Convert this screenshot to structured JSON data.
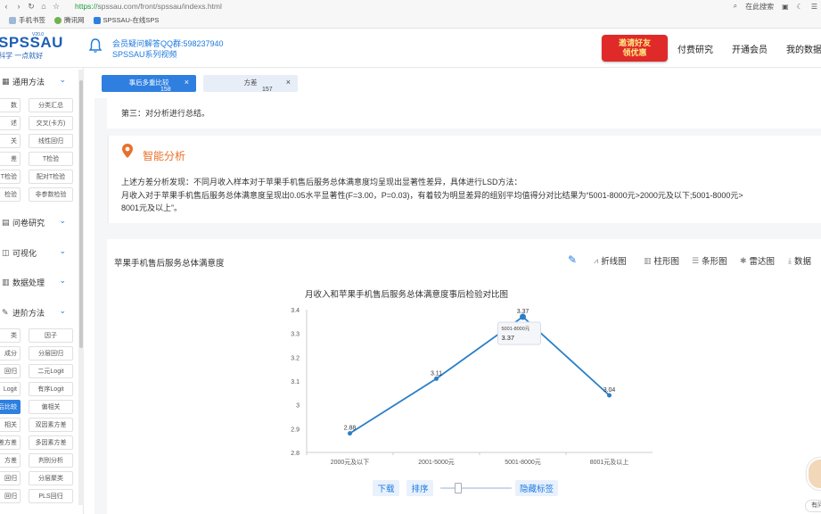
{
  "browser": {
    "url_proto": "https://",
    "url_rest": "spssau.com/front/spssau/indexs.html",
    "search_label": "在此搜索",
    "bookmarks": [
      "手机书签",
      "腾讯网",
      "SPSSAU-在线SPS"
    ]
  },
  "header": {
    "logo": "SPSSAU",
    "logo_sub": "科学  一点就好",
    "logo_version": "V20.0",
    "qq_group": "会员疑问解答QQ群:598237940",
    "video_link": "SPSSAU系列视频",
    "invite_line1": "邀请好友",
    "invite_line2": "领优惠",
    "nav": [
      "付费研究",
      "开通会员",
      "我的数据"
    ]
  },
  "sidebar": {
    "sections": [
      {
        "label": "通用方法",
        "icon": "grid-icon"
      },
      {
        "label": "问卷研究",
        "icon": "form-icon"
      },
      {
        "label": "可视化",
        "icon": "chart-icon"
      },
      {
        "label": "数据处理",
        "icon": "data-icon"
      },
      {
        "label": "进阶方法",
        "icon": "tool-icon"
      }
    ],
    "general_methods": [
      [
        "数",
        "分类汇总"
      ],
      [
        "述",
        "交叉(卡方)"
      ],
      [
        "关",
        "线性回归"
      ],
      [
        "差",
        "T检验"
      ],
      [
        "T检验",
        "配对T检验"
      ],
      [
        "检验",
        "非参数检验"
      ]
    ],
    "advanced_methods": [
      [
        "类",
        "因子"
      ],
      [
        "成分",
        "分层回归"
      ],
      [
        "回归",
        "二元Logit"
      ],
      [
        "Logit",
        "有序Logit"
      ],
      [
        "事后比较",
        "偏相关"
      ],
      [
        "相关",
        "双因素方差"
      ],
      [
        "差方差",
        "多因素方差"
      ],
      [
        "方差",
        "判别分析"
      ],
      [
        "回归",
        "分层聚类"
      ],
      [
        "回归",
        "PLS回归"
      ]
    ]
  },
  "tabs": [
    {
      "label": "事后多重比较",
      "count": "158",
      "close": "×",
      "active": true
    },
    {
      "label": "方差",
      "count": "157",
      "close": "×",
      "active": false
    }
  ],
  "content": {
    "step3": "第三：对分析进行总结。",
    "smart_title": "智能分析",
    "para1": "上述方差分析发现：不同月收入样本对于苹果手机售后服务总体满意度均呈现出显著性差异，具体进行LSD方法：",
    "para2": "月收入对于苹果手机售后服务总体满意度呈现出0.05水平显著性(F=3.00，P=0.03)，有着较为明显差异的组别平均值得分对比结果为“5001-8000元>2000元及以下;5001-8000元>",
    "para3": "8001元及以上”。",
    "chart_section_title": "苹果手机售后服务总体满意度",
    "tools": [
      "折线图",
      "柱形图",
      "条形图",
      "雷达图",
      "数据"
    ],
    "footer": {
      "download": "下载",
      "sort": "排序",
      "hide_labels": "隐藏标签"
    },
    "avatar_tag": "有问"
  },
  "colors": {
    "primary": "#2e7fe0",
    "line": "#2a7fc9",
    "accent_orange": "#e9702a",
    "invite_red": "#e02a2a"
  },
  "chart_data": {
    "type": "line",
    "title": "月收入和苹果手机售后服务总体满意度事后检验对比图",
    "categories": [
      "2000元及以下",
      "2001-5000元",
      "5001-8000元",
      "8001元及以上"
    ],
    "values": [
      2.88,
      3.11,
      3.37,
      3.04
    ],
    "ylim": [
      2.8,
      3.4
    ],
    "yticks": [
      2.8,
      2.9,
      3,
      3.1,
      3.2,
      3.3,
      3.4
    ],
    "grid": false,
    "tooltip": {
      "category": "5001-8000元",
      "value": "3.37"
    }
  }
}
